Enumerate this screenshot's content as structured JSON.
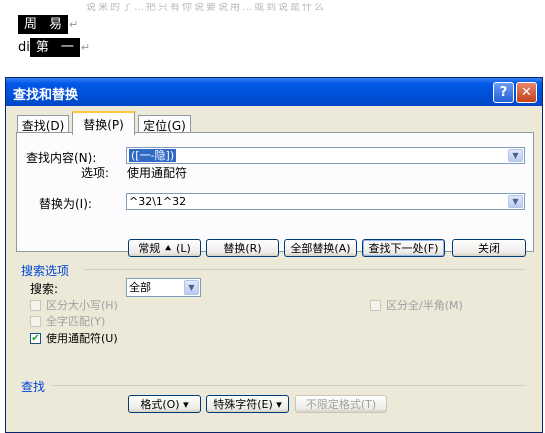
{
  "document": {
    "faint_text": "说来的了…把只有你说要说用…或到说是什么",
    "line1": [
      "周",
      "易"
    ],
    "line2_prefix": "di",
    "line2_selected": [
      "第",
      "一"
    ],
    "paragraph_mark": "↵"
  },
  "dialog": {
    "title": "查找和替换",
    "help_label": "?",
    "close_label": "✕",
    "tabs": [
      {
        "label": "查找(D)"
      },
      {
        "label": "替换(P)"
      },
      {
        "label": "定位(G)"
      }
    ],
    "find_label": "查找内容(N):",
    "find_value": "([一-隐])",
    "options_label": "选项:",
    "options_value": "使用通配符",
    "replace_label": "替换为(I):",
    "replace_value": "^32\\1^32",
    "buttons": {
      "less": "常规 ⯅ (L)",
      "replace": "替换(R)",
      "replace_all": "全部替换(A)",
      "find_next": "查找下一处(F)",
      "close": "关闭"
    },
    "search_options_title": "搜索选项",
    "search_label": "搜索:",
    "search_value": "全部",
    "checkboxes": {
      "match_case": "区分大小写(H)",
      "whole_word": "全字匹配(Y)",
      "wildcards": "使用通配符(U)",
      "full_half": "区分全/半角(M)"
    },
    "find_section_title": "查找",
    "bottom_buttons": {
      "format": "格式(O) ▾",
      "special": "特殊字符(E) ▾",
      "no_format": "不限定格式(T)"
    }
  }
}
